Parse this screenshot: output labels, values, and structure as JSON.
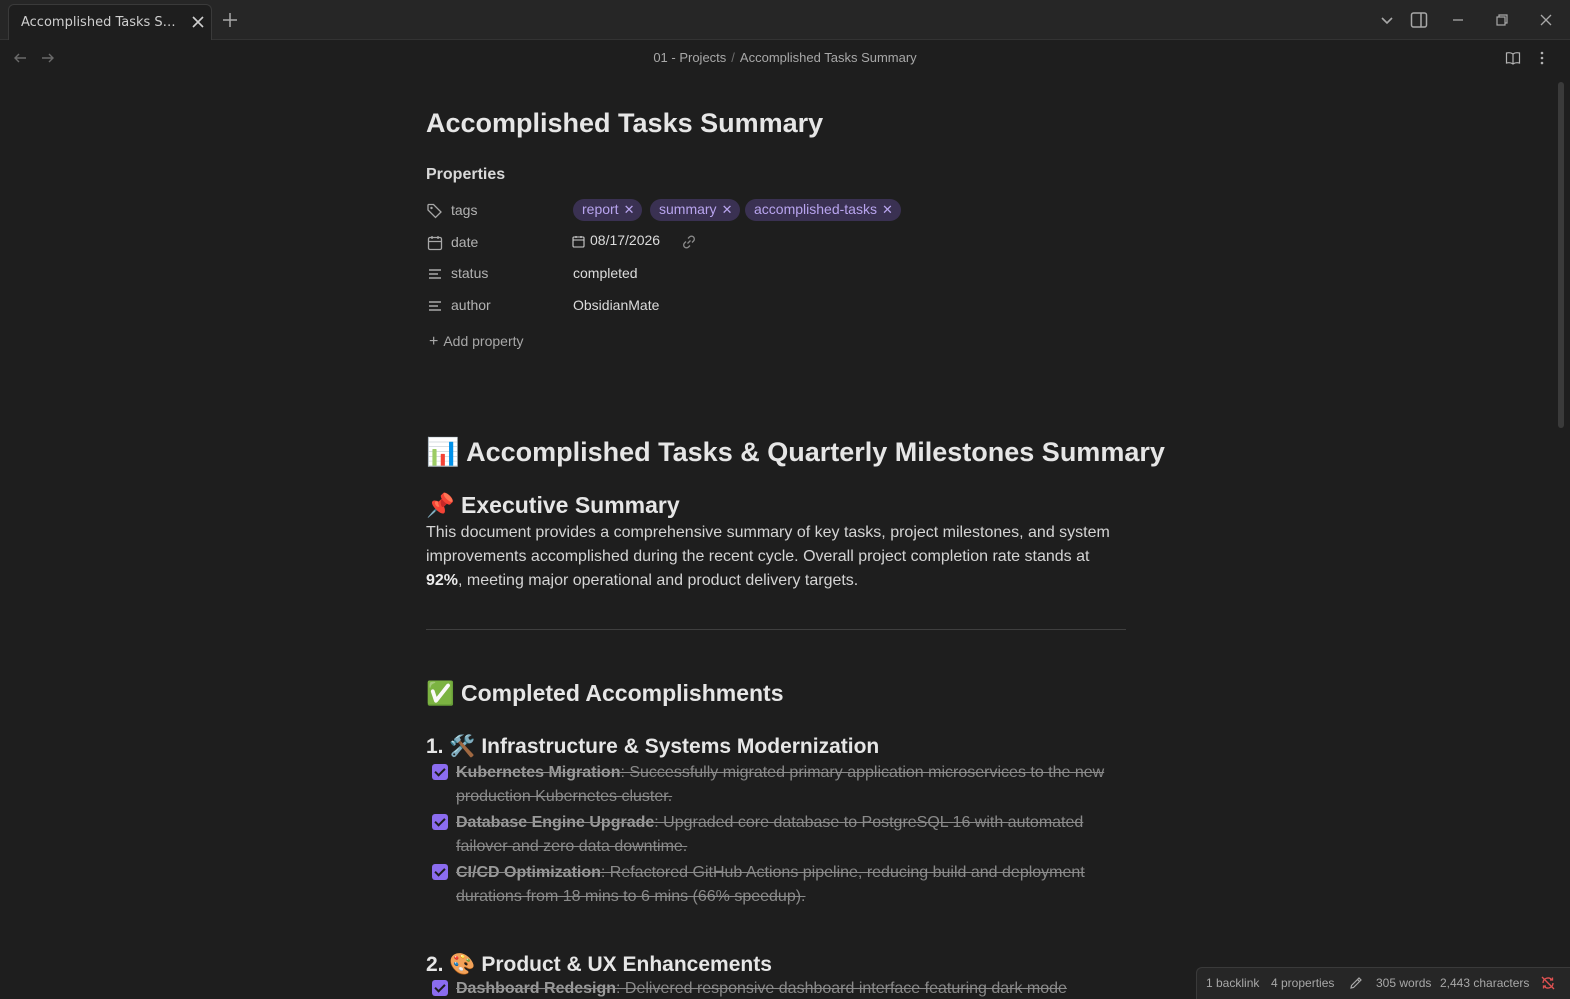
{
  "tab": {
    "title": "Accomplished Tasks Summary"
  },
  "breadcrumb": {
    "folder": "01 - Projects",
    "separator": "/",
    "file": "Accomplished Tasks Summary"
  },
  "note": {
    "title": "Accomplished Tasks Summary",
    "properties_heading": "Properties",
    "properties": {
      "tags": {
        "key": "tags",
        "values": [
          "report",
          "summary",
          "accomplished-tasks"
        ]
      },
      "date": {
        "key": "date",
        "value": "08/17/2026"
      },
      "status": {
        "key": "status",
        "value": "completed"
      },
      "author": {
        "key": "author",
        "value": "ObsidianMate"
      }
    },
    "add_property": "Add property",
    "h1": "📊 Accomplished Tasks & Quarterly Milestones Summary",
    "exec_heading": "📌 Executive Summary",
    "exec_text_before": "This document provides a comprehensive summary of key tasks, project milestones, and system improvements accomplished during the recent cycle. Overall project completion rate stands at ",
    "exec_bold": "92%",
    "exec_text_after": ", meeting major operational and product delivery targets.",
    "completed_heading": "✅ Completed Accomplishments",
    "section1_heading": "1. 🛠️ Infrastructure & Systems Modernization",
    "section1_tasks": [
      {
        "title": "Kubernetes Migration",
        "desc": ": Successfully migrated primary application microservices to the new production Kubernetes cluster."
      },
      {
        "title": "Database Engine Upgrade",
        "desc": ": Upgraded core database to PostgreSQL 16 with automated failover and zero data downtime."
      },
      {
        "title": "CI/CD Optimization",
        "desc": ": Refactored GitHub Actions pipeline, reducing build and deployment durations from 18 mins to 6 mins (66% speedup)."
      }
    ],
    "section2_heading": "2. 🎨 Product & UX Enhancements",
    "section2_tasks": [
      {
        "title": "Dashboard Redesign",
        "desc": ": Delivered responsive dashboard interface featuring dark mode"
      }
    ]
  },
  "statusbar": {
    "backlinks": "1 backlink",
    "properties": "4 properties",
    "words": "305 words",
    "characters": "2,443 characters"
  },
  "colors": {
    "accent": "#8b6cef",
    "tag_bg": "#3a3152",
    "tag_text": "#b8a4ee",
    "background": "#1e1e1e"
  },
  "icons": [
    "close-icon",
    "plus-icon",
    "chevron-down-icon",
    "sidebar-toggle-icon",
    "minimize-icon",
    "restore-icon",
    "back-arrow-icon",
    "forward-arrow-icon",
    "book-icon",
    "more-icon",
    "tag-icon",
    "calendar-icon",
    "text-lines-icon",
    "link-icon",
    "pencil-icon",
    "sync-off-icon"
  ]
}
